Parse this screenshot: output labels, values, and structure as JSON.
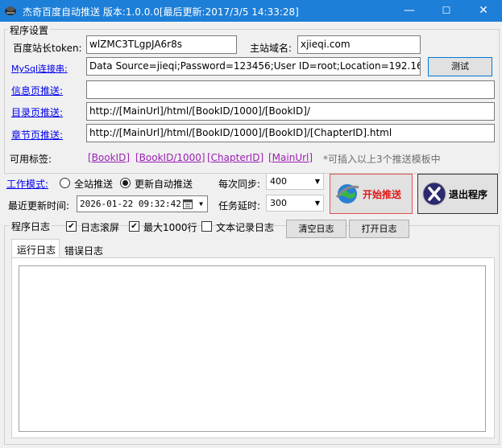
{
  "window": {
    "title": "杰奇百度自动推送 版本:1.0.0.0[最后更新:2017/3/5 14:33:28]",
    "minimize": "—",
    "maximize": "☐",
    "close": "✕"
  },
  "settings": {
    "legend": "程序设置",
    "token_label": "百度站长token:",
    "token_value": "wlZMC3TLgpJA6r8s",
    "domain_label": "主站域名:",
    "domain_value": "xjieqi.com",
    "mysql_label": "MySql连接串:",
    "mysql_value": "Data Source=jieqi;Password=123456;User ID=root;Location=192.168.1",
    "test_button": "测试",
    "info_label": "信息页推送:",
    "info_value": "",
    "catalog_label": "目录页推送:",
    "catalog_value": "http://[MainUrl]/html/[BookID/1000]/[BookID]/",
    "chapter_label": "章节页推送:",
    "chapter_value": "http://[MainUrl]/html/[BookID/1000]/[BookID]/[ChapterID].html",
    "tags_label": "可用标签:",
    "tags": [
      "[BookID]",
      "[BookID/1000]",
      "[ChapterID]",
      "[MainUrl]"
    ],
    "tags_hint": "*可插入以上3个推送模板中"
  },
  "work": {
    "mode_label": "工作模式:",
    "mode_options": [
      "全站推送",
      "更新自动推送"
    ],
    "mode_selected": "更新自动推送",
    "last_update_label": "最近更新时间:",
    "last_update_value": "2026-01-22 09:32:42",
    "sync_label": "每次同步:",
    "sync_value": "400",
    "delay_label": "任务延时:",
    "delay_value": "300",
    "start_button": "开始推送",
    "exit_button": "退出程序"
  },
  "log": {
    "legend": "程序日志",
    "options": [
      {
        "label": "日志滚屏",
        "checked": true
      },
      {
        "label": "最大1000行",
        "checked": true
      },
      {
        "label": "文本记录日志",
        "checked": false
      }
    ],
    "clear_button": "清空日志",
    "open_button": "打开日志",
    "tabs": [
      "运行日志",
      "错误日志"
    ],
    "active_tab": "运行日志"
  },
  "colors": {
    "titlebar": "#1d7fd8",
    "link": "#0000ee",
    "tag": "#9b1fb3",
    "start_text": "#e01818",
    "start_border": "#e05050"
  }
}
